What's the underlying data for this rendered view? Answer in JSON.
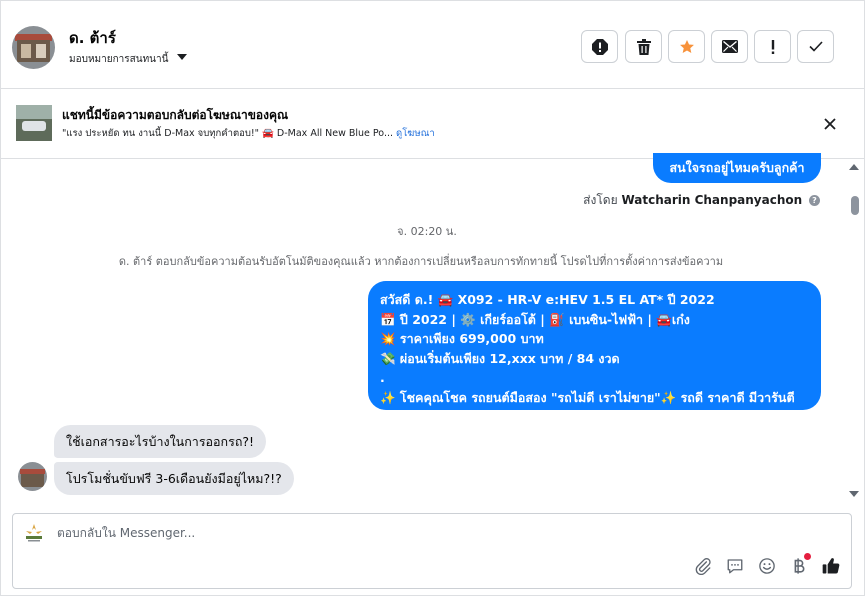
{
  "header": {
    "contact_name": "ด. ต้าร์",
    "assign_label": "มอบหมายการสนทนานี้",
    "actions": [
      {
        "name": "mark-spam-icon"
      },
      {
        "name": "trash-icon"
      },
      {
        "name": "star-icon"
      },
      {
        "name": "mark-unread-icon"
      },
      {
        "name": "follow-up-icon"
      },
      {
        "name": "mark-done-icon"
      }
    ],
    "accent_star": "#f7923b"
  },
  "ad_banner": {
    "title": "แชทนี้มีข้อความตอบกลับต่อโฆษณาของคุณ",
    "subtitle": "\"แรง ประหยัด ทน งานนี้ D-Max จบทุกคำตอบ!\" 🚘 D-Max All New Blue Po...",
    "link_label": "ดูโฆษณา"
  },
  "messages": {
    "top_outgoing": "สนใจรถอยู่ไหมครับลูกค้า",
    "sent_by_prefix": "ส่งโดย",
    "sent_by_name": "Watcharin Chanpanyachon",
    "timestamp": "จ. 02:20 น.",
    "system_notice": "ด. ต้าร์ ตอบกลับข้อความต้อนรับอัตโนมัติของคุณแล้ว หากต้องการเปลี่ยนหรือลบการทักทายนี้ โปรดไปที่การตั้งค่าการส่งข้อความ",
    "outgoing_lines": [
      "สวัสดี ด.! 🚘 X092 - HR-V e:HEV 1.5 EL AT* ปี 2022",
      "📅 ปี 2022 | ⚙️ เกียร์ออโต้ | ⛽ เบนซิน-ไฟฟ้า | 🚘เก๋ง",
      "💥 ราคาเพียง 699,000 บาท",
      "💸 ผ่อนเริ่มต้นเพียง 12,xxx บาท / 84 งวด",
      ".",
      "✨ โชคคุณโชค รถยนต์มือสอง \"รถไม่ดี เราไม่ขาย\"✨ รถดี ราคาดี มีวารันตี"
    ],
    "incoming": [
      "ใช้เอกสารอะไรบ้างในการออกรถ?!",
      "โปรโมชั่นขับฟรี 3-6เดือนยังมีอยู่ไหม?!?"
    ],
    "outgoing_color": "#0a7cff",
    "incoming_color": "#e4e6eb"
  },
  "composer": {
    "placeholder": "ตอบกลับใน Messenger...",
    "icons": [
      "attachment-icon",
      "saved-replies-icon",
      "emoji-icon",
      "payment-baht-icon",
      "like-icon"
    ]
  }
}
